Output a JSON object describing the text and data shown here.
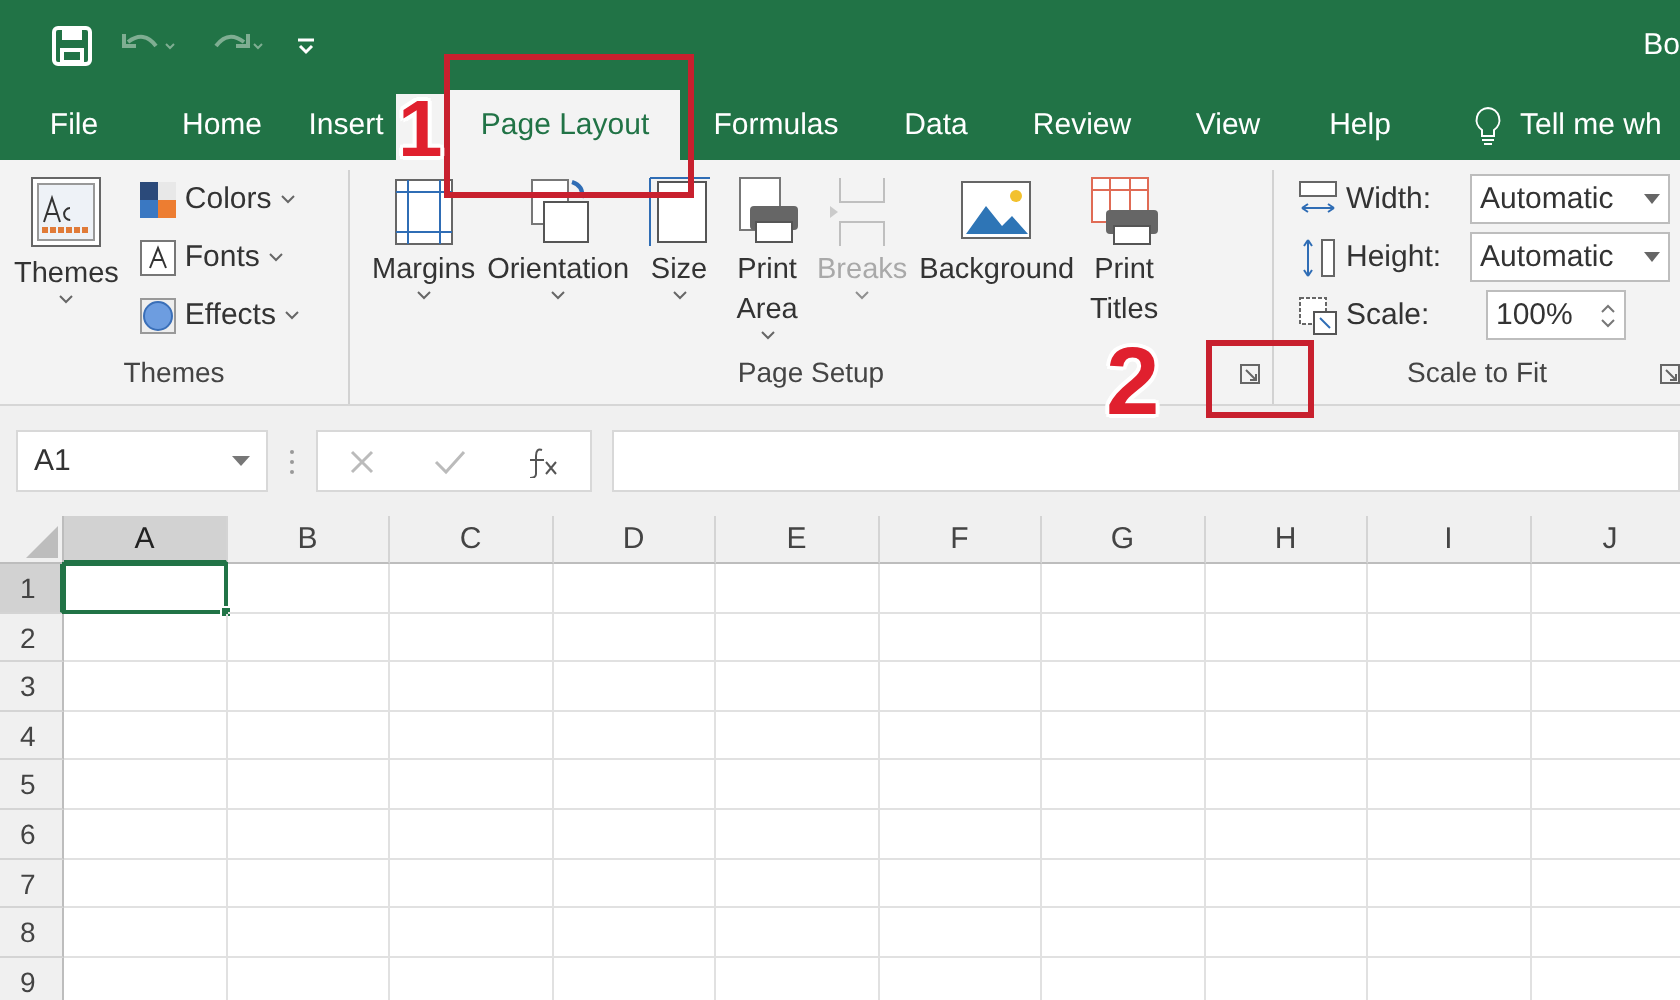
{
  "title_bar": {
    "title": "Bo"
  },
  "tabs": [
    {
      "label": "File",
      "selected": false
    },
    {
      "label": "Home",
      "selected": false
    },
    {
      "label": "Insert",
      "selected": false
    },
    {
      "label": "Page Layout",
      "selected": true
    },
    {
      "label": "Formulas",
      "selected": false
    },
    {
      "label": "Data",
      "selected": false
    },
    {
      "label": "Review",
      "selected": false
    },
    {
      "label": "View",
      "selected": false
    },
    {
      "label": "Help",
      "selected": false
    }
  ],
  "tell_me": {
    "placeholder": "Tell me wh"
  },
  "themes_group": {
    "label": "Themes",
    "themes": {
      "label": "Themes"
    },
    "options": [
      {
        "kind": "colors",
        "label": "Colors"
      },
      {
        "kind": "fonts",
        "label": "Fonts"
      },
      {
        "kind": "effects",
        "label": "Effects"
      }
    ]
  },
  "page_setup_group": {
    "label": "Page Setup",
    "items": [
      {
        "kind": "margins",
        "label": "Margins",
        "disabled": false,
        "dropdown": true
      },
      {
        "kind": "orientation",
        "label": "Orientation",
        "disabled": false,
        "dropdown": true
      },
      {
        "kind": "size",
        "label": "Size",
        "disabled": false,
        "dropdown": true
      },
      {
        "kind": "print_area",
        "label": "Print Area",
        "disabled": false,
        "dropdown": true
      },
      {
        "kind": "breaks",
        "label": "Breaks",
        "disabled": true,
        "dropdown": true
      },
      {
        "kind": "background",
        "label": "Background",
        "disabled": false,
        "dropdown": false
      },
      {
        "kind": "print_titles",
        "label": "Print Titles",
        "disabled": false,
        "dropdown": false
      }
    ]
  },
  "scale_group": {
    "label": "Scale to Fit",
    "fields": [
      {
        "kind": "width",
        "label": "Width:",
        "value": "Automatic"
      },
      {
        "kind": "height",
        "label": "Height:",
        "value": "Automatic"
      },
      {
        "kind": "scale",
        "label": "Scale:",
        "value": "100%"
      }
    ]
  },
  "name_box": {
    "value": "A1"
  },
  "grid": {
    "columns": [
      {
        "label": "A",
        "selected": true
      },
      {
        "label": "B",
        "selected": false
      },
      {
        "label": "C",
        "selected": false
      },
      {
        "label": "D",
        "selected": false
      },
      {
        "label": "E",
        "selected": false
      },
      {
        "label": "F",
        "selected": false
      },
      {
        "label": "G",
        "selected": false
      },
      {
        "label": "H",
        "selected": false
      },
      {
        "label": "I",
        "selected": false
      },
      {
        "label": "J",
        "selected": false
      }
    ],
    "rows": [
      {
        "label": "1",
        "selected": true
      },
      {
        "label": "2",
        "selected": false
      },
      {
        "label": "3",
        "selected": false
      },
      {
        "label": "4",
        "selected": false
      },
      {
        "label": "5",
        "selected": false
      },
      {
        "label": "6",
        "selected": false
      },
      {
        "label": "7",
        "selected": false
      },
      {
        "label": "8",
        "selected": false
      },
      {
        "label": "9",
        "selected": false
      }
    ]
  },
  "annotations": [
    {
      "label": "1"
    },
    {
      "label": "2"
    }
  ]
}
